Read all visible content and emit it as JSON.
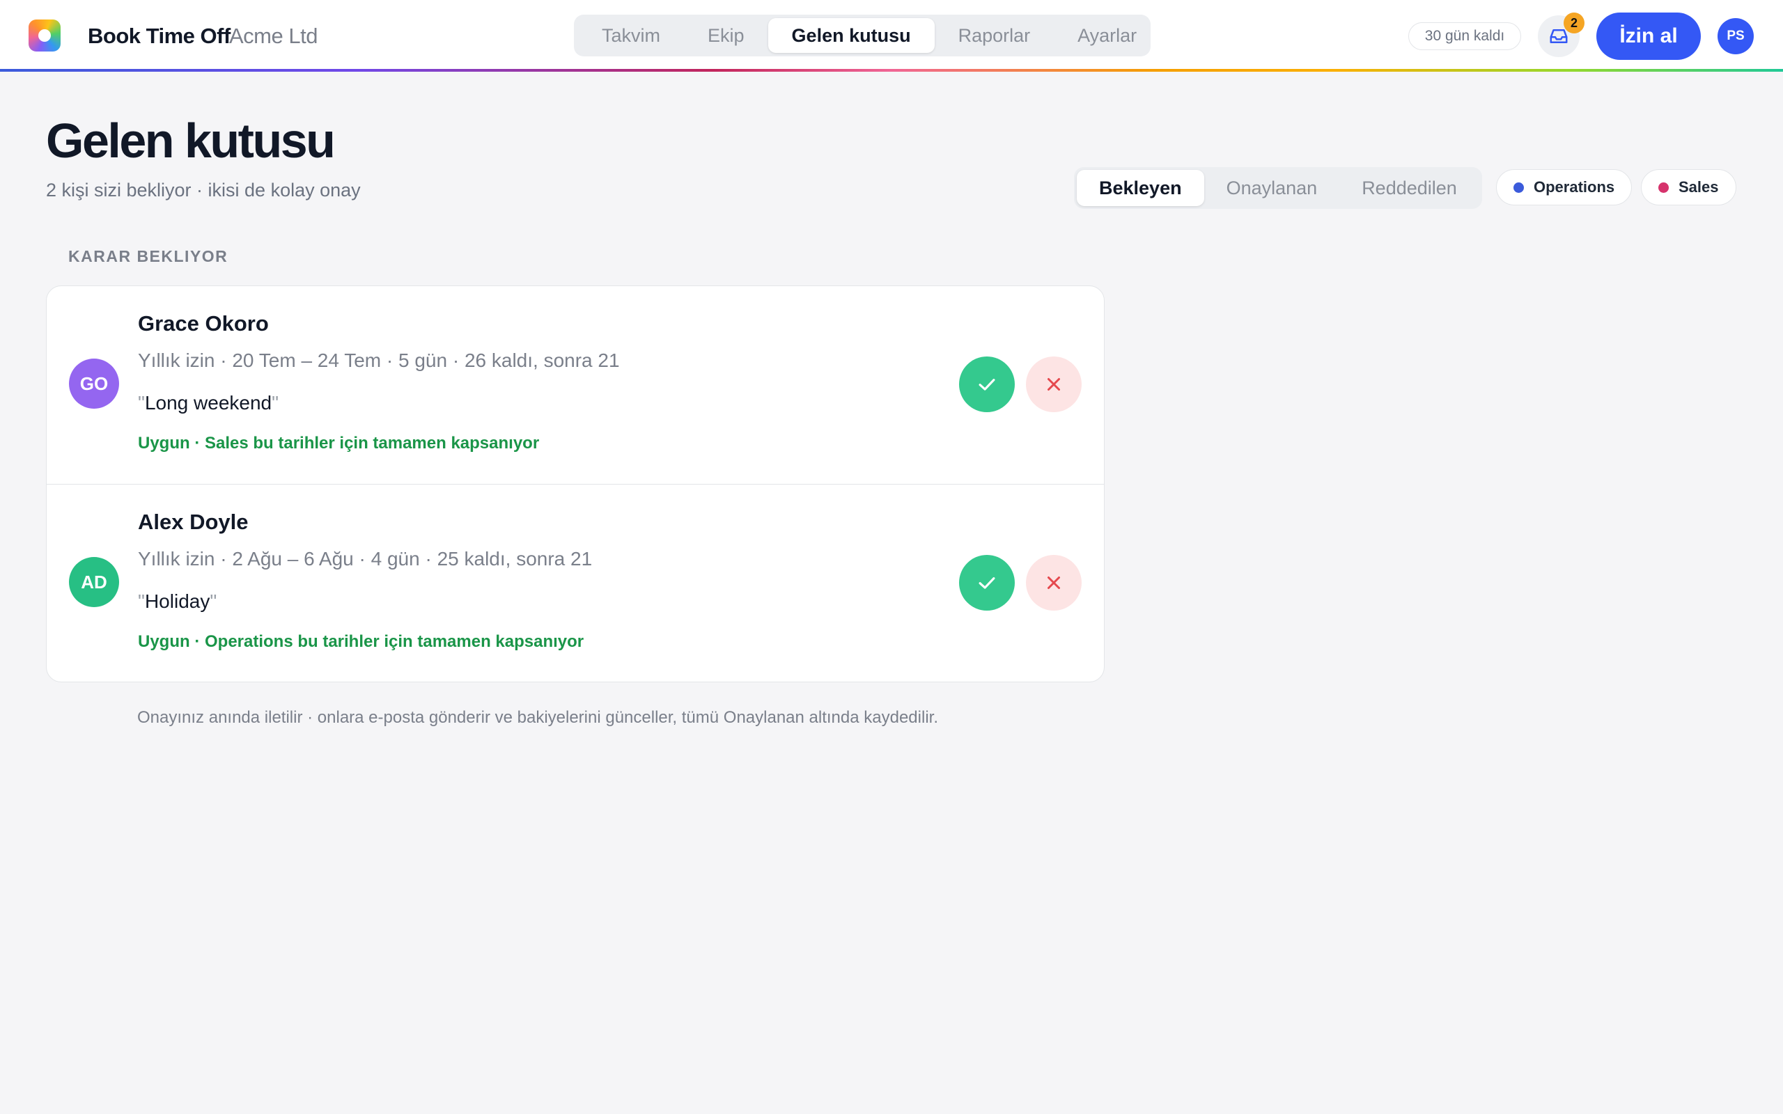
{
  "header": {
    "brand": "Book Time Off",
    "org": "Acme Ltd",
    "nav": [
      "Takvim",
      "Ekip",
      "Gelen kutusu",
      "Raporlar",
      "Ayarlar"
    ],
    "active_nav": "Gelen kutusu",
    "days_left": "30 gün kaldı",
    "inbox_count": "2",
    "cta_label": "İzin al",
    "user_initials": "PS"
  },
  "page": {
    "title": "Gelen kutusu",
    "subtitle": "2 kişi sizi bekliyor · ikisi de kolay onay"
  },
  "filters": {
    "tabs": [
      "Bekleyen",
      "Onaylanan",
      "Reddedilen"
    ],
    "active": "Bekleyen",
    "teams": [
      {
        "name": "Operations",
        "color": "#3b5bdb"
      },
      {
        "name": "Sales",
        "color": "#d6336c"
      }
    ]
  },
  "section_label": "KARAR BEKLIYOR",
  "requests": [
    {
      "initials": "GO",
      "avatar_color": "#9466f0",
      "name": "Grace Okoro",
      "meta": "Yıllık izin · 20 Tem – 24 Tem · 5 gün · 26 kaldı, sonra 21",
      "note": "Long weekend",
      "status": "Uygun · Sales bu tarihler için tamamen kapsanıyor"
    },
    {
      "initials": "AD",
      "avatar_color": "#27bf84",
      "name": "Alex Doyle",
      "meta": "Yıllık izin · 2 Ağu – 6 Ağu · 4 gün · 25 kaldı, sonra 21",
      "note": "Holiday",
      "status": "Uygun · Operations bu tarihler için tamamen kapsanıyor"
    }
  ],
  "footnote": "Onayınız anında iletilir · onlara e-posta gönderir ve bakiyelerini günceller, tümü Onaylanan altında kaydedilir.",
  "icons": {
    "inbox": "inbox-icon",
    "approve": "check-icon",
    "reject": "close-icon"
  }
}
